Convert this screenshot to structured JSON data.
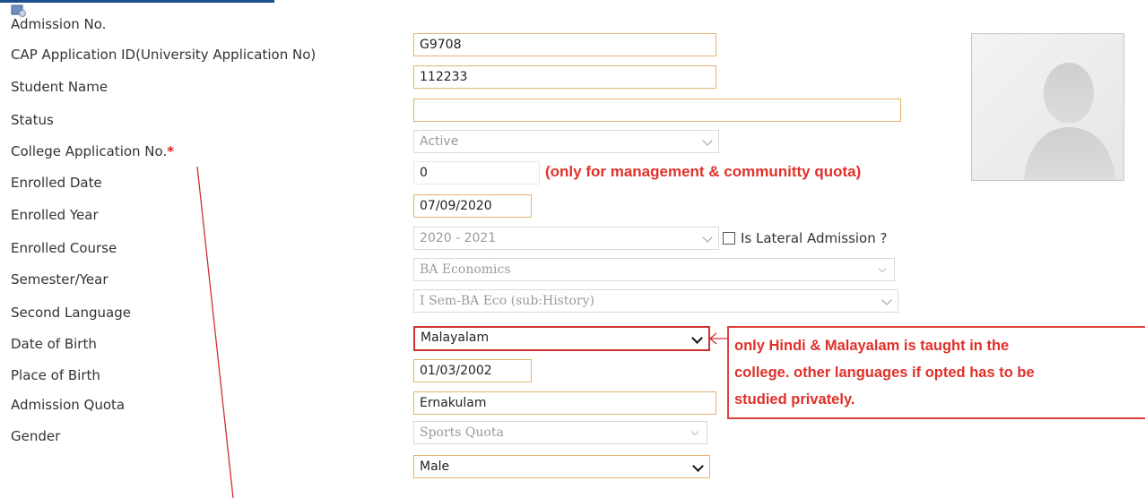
{
  "form": {
    "admission_no": {
      "label": "Admission No.",
      "value": "G9708"
    },
    "cap_id": {
      "label": "CAP Application ID(University Application No)",
      "value": "112233"
    },
    "student_name": {
      "label": "Student Name",
      "value": ""
    },
    "status": {
      "label": "Status",
      "value": "Active"
    },
    "college_app_no": {
      "label": "College Application No.",
      "required_mark": "*",
      "value": "0"
    },
    "enrolled_date": {
      "label": "Enrolled Date",
      "value": "07/09/2020"
    },
    "enrolled_year": {
      "label": "Enrolled Year",
      "value": "2020 - 2021"
    },
    "lateral": {
      "label": "Is Lateral Admission ?"
    },
    "enrolled_course": {
      "label": "Enrolled Course",
      "value": "BA Economics"
    },
    "semester": {
      "label": "Semester/Year",
      "value": "I Sem-BA Eco (sub:History)"
    },
    "second_language": {
      "label": "Second Language",
      "value": "Malayalam"
    },
    "dob": {
      "label": "Date of Birth",
      "value": "01/03/2002"
    },
    "place_of_birth": {
      "label": "Place of Birth",
      "value": "Ernakulam"
    },
    "admission_quota": {
      "label": "Admission Quota",
      "value": "Sports Quota"
    },
    "gender": {
      "label": "Gender",
      "value": "Male"
    }
  },
  "annotations": {
    "quota_note": "(only for management & communitty quota)",
    "language_note": [
      "only Hindi & Malayalam is taught in the",
      "college. other languages if opted has to be",
      "studied privately."
    ]
  },
  "colors": {
    "accent_red": "#e0302a",
    "field_border": "#e3b36c",
    "header_bar": "#1f4e8c"
  },
  "icons": {
    "page": "page-icon",
    "photo": "avatar-placeholder"
  }
}
